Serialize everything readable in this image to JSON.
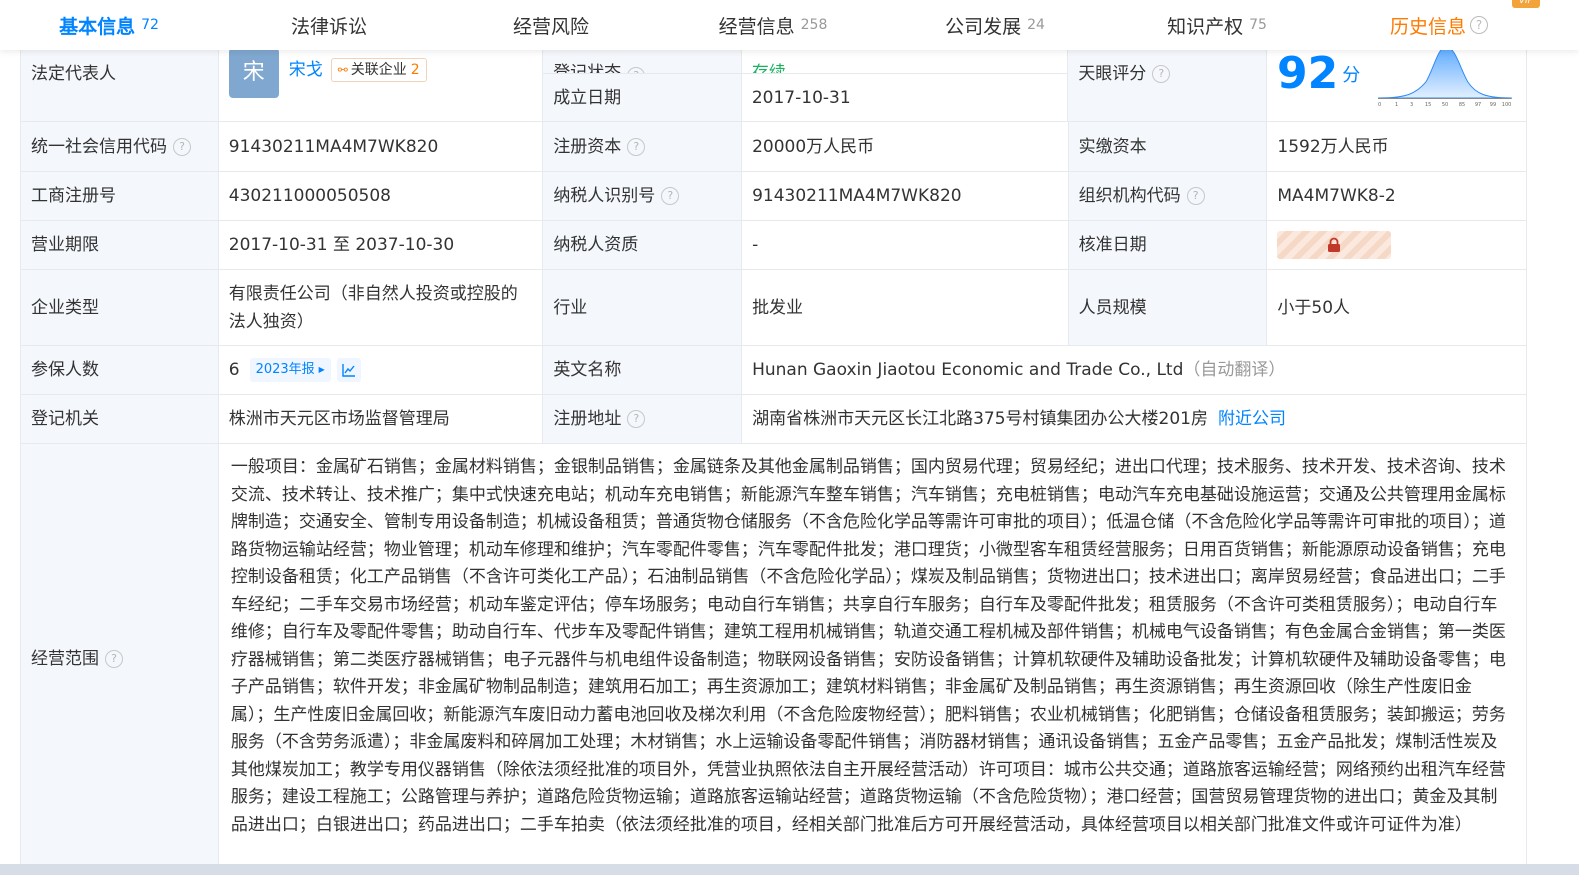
{
  "tabs": [
    {
      "label": "基本信息",
      "count": "72",
      "active": true
    },
    {
      "label": "法律诉讼",
      "count": ""
    },
    {
      "label": "经营风险",
      "count": ""
    },
    {
      "label": "经营信息",
      "count": "258"
    },
    {
      "label": "公司发展",
      "count": "24"
    },
    {
      "label": "知识产权",
      "count": "75"
    },
    {
      "label": "历史信息",
      "count": ""
    }
  ],
  "vip_tag": "VIP",
  "legal_rep": {
    "label": "法定代表人",
    "avatar_char": "宋",
    "name": "宋戈",
    "assoc_label": "关联企业",
    "assoc_count": "2"
  },
  "status_label": "登记状态",
  "status_value": "存续",
  "founded_label": "成立日期",
  "founded_value": "2017-10-31",
  "tianyan": {
    "label": "天眼评分",
    "score": "92",
    "unit": "分",
    "axis": [
      "0",
      "1",
      "3",
      "15",
      "50",
      "85",
      "97",
      "99",
      "100"
    ]
  },
  "rows": {
    "credit_code": {
      "label": "统一社会信用代码",
      "value": "91430211MA4M7WK820"
    },
    "reg_capital": {
      "label": "注册资本",
      "value": "20000万人民币"
    },
    "paid_capital": {
      "label": "实缴资本",
      "value": "1592万人民币"
    },
    "biz_reg_no": {
      "label": "工商注册号",
      "value": "430211000050508"
    },
    "taxpayer_id": {
      "label": "纳税人识别号",
      "value": "91430211MA4M7WK820"
    },
    "org_code": {
      "label": "组织机构代码",
      "value": "MA4M7WK8-2"
    },
    "biz_term": {
      "label": "营业期限",
      "value": "2017-10-31 至 2037-10-30"
    },
    "taxpayer_qual": {
      "label": "纳税人资质",
      "value": "-"
    },
    "approve_date": {
      "label": "核准日期"
    },
    "company_type": {
      "label": "企业类型",
      "value": "有限责任公司（非自然人投资或控股的法人独资）"
    },
    "industry": {
      "label": "行业",
      "value": "批发业"
    },
    "staff_size": {
      "label": "人员规模",
      "value": "小于50人"
    },
    "insured": {
      "label": "参保人数",
      "value": "6",
      "year_tag": "2023年报"
    },
    "english_name": {
      "label": "英文名称",
      "value": "Hunan Gaoxin Jiaotou Economic and Trade Co., Ltd",
      "note": "（自动翻译）"
    },
    "reg_authority": {
      "label": "登记机关",
      "value": "株洲市天元区市场监督管理局"
    },
    "reg_address": {
      "label": "注册地址",
      "value": "湖南省株洲市天元区长江北路375号村镇集团办公大楼201房",
      "link": "附近公司"
    },
    "biz_scope": {
      "label": "经营范围",
      "value": "一般项目：金属矿石销售；金属材料销售；金银制品销售；金属链条及其他金属制品销售；国内贸易代理；贸易经纪；进出口代理；技术服务、技术开发、技术咨询、技术交流、技术转让、技术推广；集中式快速充电站；机动车充电销售；新能源汽车整车销售；汽车销售；充电桩销售；电动汽车充电基础设施运营；交通及公共管理用金属标牌制造；交通安全、管制专用设备制造；机械设备租赁；普通货物仓储服务（不含危险化学品等需许可审批的项目）；低温仓储（不含危险化学品等需许可审批的项目）；道路货物运输站经营；物业管理；机动车修理和维护；汽车零配件零售；汽车零配件批发；港口理货；小微型客车租赁经营服务；日用百货销售；新能源原动设备销售；充电控制设备租赁；化工产品销售（不含许可类化工产品）；石油制品销售（不含危险化学品）；煤炭及制品销售；货物进出口；技术进出口；离岸贸易经营；食品进出口；二手车经纪；二手车交易市场经营；机动车鉴定评估；停车场服务；电动自行车销售；共享自行车服务；自行车及零配件批发；租赁服务（不含许可类租赁服务）；电动自行车维修；自行车及零配件零售；助动自行车、代步车及零配件销售；建筑工程用机械销售；轨道交通工程机械及部件销售；机械电气设备销售；有色金属合金销售；第一类医疗器械销售；第二类医疗器械销售；电子元器件与机电组件设备制造；物联网设备销售；安防设备销售；计算机软硬件及辅助设备批发；计算机软硬件及辅助设备零售；电子产品销售；软件开发；非金属矿物制品制造；建筑用石加工；再生资源加工；建筑材料销售；非金属矿及制品销售；再生资源销售；再生资源回收（除生产性废旧金属）；生产性废旧金属回收；新能源汽车废旧动力蓄电池回收及梯次利用（不含危险废物经营）；肥料销售；农业机械销售；化肥销售；仓储设备租赁服务；装卸搬运；劳务服务（不含劳务派遣）；非金属废料和碎屑加工处理；木材销售；水上运输设备零配件销售；消防器材销售；通讯设备销售；五金产品零售；五金产品批发；煤制活性炭及其他煤炭加工；教学专用仪器销售（除依法须经批准的项目外，凭营业执照依法自主开展经营活动）许可项目：城市公共交通；道路旅客运输经营；网络预约出租汽车经营服务；建设工程施工；公路管理与养护；道路危险货物运输；道路旅客运输站经营；道路货物运输（不含危险货物）；港口经营；国营贸易管理货物的进出口；黄金及其制品进出口；白银进出口；药品进出口；二手车拍卖（依法须经批准的项目，经相关部门批准后方可开展经营活动，具体经营项目以相关部门批准文件或许可证件为准）"
    }
  },
  "colors": {
    "accent": "#0084ff",
    "history": "#ff7a00",
    "label_bg": "#f4f7fb",
    "border": "#e6e9ee"
  }
}
